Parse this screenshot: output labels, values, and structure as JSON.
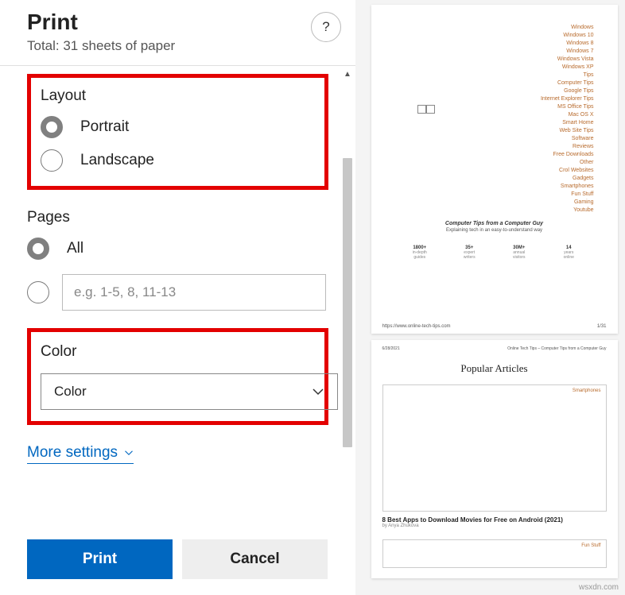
{
  "header": {
    "title": "Print",
    "subtitle": "Total: 31 sheets of paper",
    "help": "?"
  },
  "layout": {
    "label": "Layout",
    "portrait": "Portrait",
    "landscape": "Landscape"
  },
  "pages": {
    "label": "Pages",
    "all": "All",
    "placeholder": "e.g. 1-5, 8, 11-13"
  },
  "color": {
    "label": "Color",
    "value": "Color"
  },
  "more": "More settings",
  "buttons": {
    "print": "Print",
    "cancel": "Cancel"
  },
  "preview": {
    "links": [
      "Windows",
      "Windows 10",
      "Windows 8",
      "Windows 7",
      "Windows Vista",
      "Windows XP",
      "Tips",
      "Computer Tips",
      "Google Tips",
      "Internet Explorer Tips",
      "MS Office Tips",
      "Mac OS X",
      "Smart Home",
      "Web Site Tips",
      "Software",
      "Reviews",
      "Free Downloads",
      "Other",
      "Crol Websites",
      "Gadgets",
      "Smartphones",
      "Fun Stuff",
      "Gaming",
      "Youtube"
    ],
    "tagline1": "Computer Tips from a Computer Guy",
    "tagline2": "Explaining tech in an easy-to-understand way",
    "stats": [
      {
        "n": "1800+",
        "l1": "in-depth",
        "l2": "guides"
      },
      {
        "n": "35+",
        "l1": "expert",
        "l2": "writers"
      },
      {
        "n": "30M+",
        "l1": "annual",
        "l2": "visitors"
      },
      {
        "n": "14",
        "l1": "years",
        "l2": "online"
      }
    ],
    "url": "https://www.online-tech-tips.com",
    "pagenum": "1/31",
    "p2": {
      "date": "6/28/2021",
      "header": "Online Tech Tips – Computer Tips from a Computer Guy",
      "title": "Popular Articles",
      "card1_tag": "Smartphones",
      "card1_title": "8 Best Apps to Download Movies for Free on Android (2021)",
      "card1_author": "by Anya Zhukova",
      "card2_tag": "Fun Stuff"
    }
  },
  "watermark": "wsxdn.com"
}
